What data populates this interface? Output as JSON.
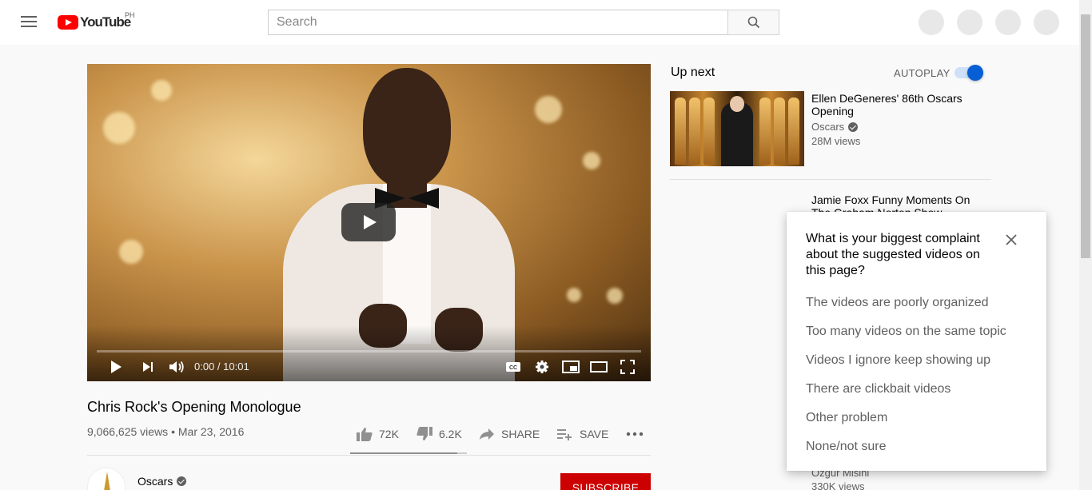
{
  "header": {
    "logo_text": "YouTube",
    "country_code": "PH",
    "search_placeholder": "Search"
  },
  "player": {
    "time_current": "0:00",
    "time_separator": " / ",
    "time_total": "10:01",
    "progress_fraction": 0
  },
  "video": {
    "title": "Chris Rock's Opening Monologue",
    "views": "9,066,625 views",
    "separator": " • ",
    "date": "Mar 23, 2016",
    "like_count": "72K",
    "dislike_count": "6.2K",
    "share_label": "SHARE",
    "save_label": "SAVE",
    "like_ratio": 0.92
  },
  "channel": {
    "name": "Oscars",
    "subscribe_label": "SUBSCRIBE"
  },
  "sidebar": {
    "up_next_label": "Up next",
    "autoplay_label": "AUTOPLAY",
    "autoplay_on": true,
    "recommendations": [
      {
        "title_line1": "Ellen DeGeneres' 86th Oscars",
        "title_line2": "Opening",
        "channel": "Oscars",
        "views": "28M views"
      },
      {
        "title_line1": "Jamie Foxx Funny Moments On",
        "title_line2": "The Graham Norton Show"
      },
      {
        "channel": "Ozgur Misini",
        "views": "330K views"
      }
    ]
  },
  "survey": {
    "question": "What is your biggest complaint about the suggested videos on this page?",
    "options": [
      "The videos are poorly organized",
      "Too many videos on the same topic",
      "Videos I ignore keep showing up",
      "There are clickbait videos",
      "Other problem",
      "None/not sure"
    ]
  },
  "colors": {
    "brand_red": "#ff0000",
    "subscribe_red": "#cc0000",
    "toggle_blue": "#065fd4"
  }
}
